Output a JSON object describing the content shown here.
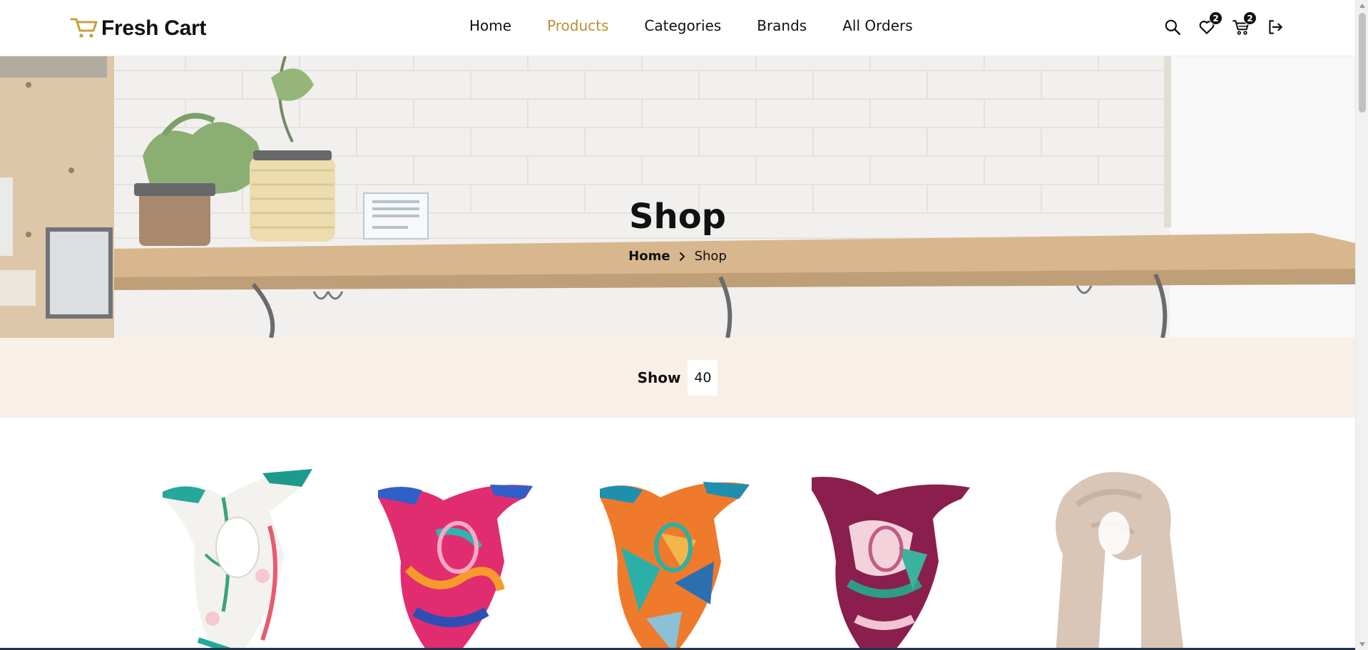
{
  "brand": {
    "name": "Fresh Cart",
    "accent_color": "#b8902f"
  },
  "nav": {
    "links": [
      {
        "label": "Home",
        "active": false
      },
      {
        "label": "Products",
        "active": true
      },
      {
        "label": "Categories",
        "active": false
      },
      {
        "label": "Brands",
        "active": false
      },
      {
        "label": "All Orders",
        "active": false
      }
    ],
    "wishlist_count": "2",
    "cart_count": "2",
    "icons": [
      "search-icon",
      "heart-icon",
      "cart-icon",
      "logout-icon"
    ]
  },
  "hero": {
    "title": "Shop",
    "breadcrumb": {
      "home": "Home",
      "current": "Shop"
    }
  },
  "show": {
    "label": "Show",
    "value": "40"
  },
  "products": [
    {
      "name": "scarf-floral-white"
    },
    {
      "name": "scarf-pink-blue"
    },
    {
      "name": "scarf-orange-teal"
    },
    {
      "name": "scarf-burgundy"
    },
    {
      "name": "scarf-beige"
    }
  ]
}
